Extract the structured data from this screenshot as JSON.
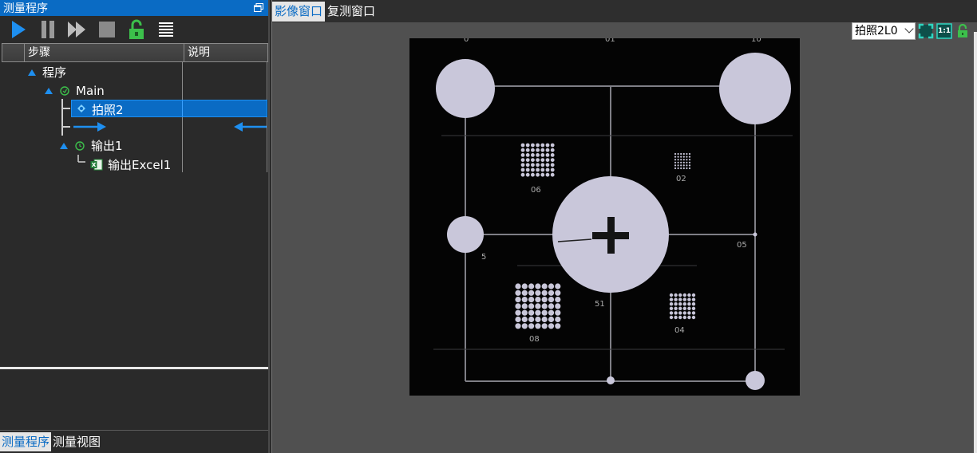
{
  "left_panel": {
    "title": "测量程序",
    "columns": {
      "step": "步骤",
      "note": "说明"
    },
    "tree": {
      "root": "程序",
      "main": "Main",
      "photo": "拍照2",
      "output": "输出1",
      "excel": "输出Excel1"
    },
    "toolbar": {
      "run_icon": "play-icon",
      "pause_icon": "pause-icon",
      "fast_icon": "fast-forward-icon",
      "stop_icon": "stop-icon",
      "lock_icon": "unlock-icon",
      "list_icon": "list-icon"
    },
    "bottom_tabs": [
      "测量程序",
      "测量视图"
    ]
  },
  "right_panel": {
    "tabs": [
      "影像窗口",
      "复测窗口"
    ],
    "camera_select": "拍照2L0",
    "controls": [
      "fit-icon",
      "one-to-one-icon",
      "lock-icon"
    ],
    "one_to_one_label": "1:1",
    "image_labels": {
      "top_left": "0",
      "top_mid": "01",
      "top_right": "10",
      "grid_06": "06",
      "grid_02": "02",
      "left_5": "5",
      "right_05": "05",
      "center_51": "51",
      "grid_08": "08",
      "grid_04": "04"
    }
  },
  "colors": {
    "accent": "#0a6bc4",
    "arrow": "#1e8ff0",
    "circle": "#c9c7da"
  }
}
